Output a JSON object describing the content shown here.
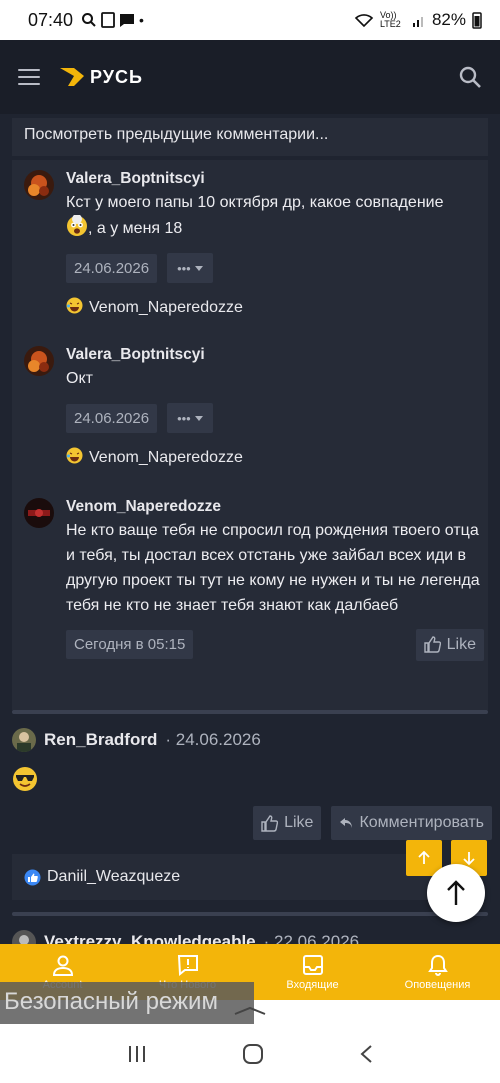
{
  "status_bar": {
    "time": "07:40",
    "network": "Vo)) LTE2",
    "battery": "82%"
  },
  "app_bar": {
    "logo_text": "РУСЬ"
  },
  "thread": {
    "prev_comments_label": "Посмотреть предыдущие комментарии...",
    "replies": [
      {
        "user": "Valera_Boptnitscyi",
        "text": "Кст у моего папы 10 октября др, какое совпадение",
        "text2": ", а у меня 18",
        "date": "24.06.2026",
        "reaction_user": "Venom_Naperedozze"
      },
      {
        "user": "Valera_Boptnitscyi",
        "text": "Окт",
        "date": "24.06.2026",
        "reaction_user": "Venom_Naperedozze"
      },
      {
        "user": "Venom_Naperedozze",
        "text": "Не кто ваще тебя не спросил год рождения твоего отца и тебя, ты достал всех отстань уже зайбал всех иди в другую проект ты тут не кому не нужен и ты не легенда тебя не кто не знает тебя знают как далбаеб",
        "date": "Сегодня в 05:15",
        "like_label": "Like"
      }
    ]
  },
  "post": {
    "user": "Ren_Bradford",
    "date": "· 24.06.2026",
    "like_label": "Like",
    "comment_label": "Комментировать",
    "liked_by": "Daniil_Weazqueze"
  },
  "next_post": {
    "user": "Vextrezzy_Knowledgeable",
    "date": "· 22.06.2026"
  },
  "bottom_nav": [
    {
      "label": "Account"
    },
    {
      "label": "Что Нового"
    },
    {
      "label": "Входящие"
    },
    {
      "label": "Оповещения"
    }
  ],
  "toast": "Безопасный режим",
  "colors": {
    "accent": "#f3b50a",
    "background": "#1f2430",
    "card": "#262b37",
    "chip": "#323847"
  }
}
